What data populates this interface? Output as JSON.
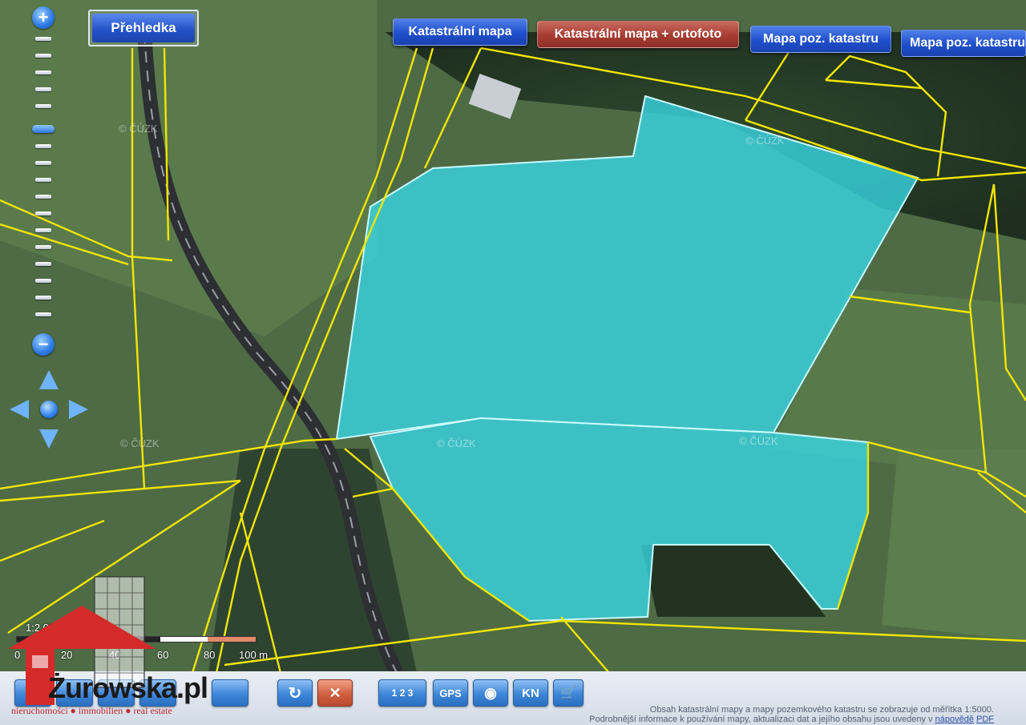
{
  "map": {
    "watermark": "© ČÚZK",
    "parcel_color": "#38d8e8",
    "boundary_color": "#f2e600"
  },
  "overview": {
    "label": "Přehledka"
  },
  "map_layers": [
    {
      "label": "Katastrální mapa",
      "style": "blue"
    },
    {
      "label": "Katastrální mapa + ortofoto",
      "style": "red",
      "selected": true
    },
    {
      "label": "Mapa poz. katastru",
      "style": "blue"
    },
    {
      "label": "Mapa poz. katastru",
      "style": "blue"
    }
  ],
  "zoom": {
    "in_label": "+",
    "out_label": "−"
  },
  "scale": {
    "ratio": "1:2 000",
    "labels": [
      "0",
      "20",
      "40",
      "60",
      "80",
      "100 m"
    ]
  },
  "toolbar": {
    "buttons": [
      {
        "name": "tool-1",
        "label": "",
        "icon": "blank-icon"
      },
      {
        "name": "tool-2",
        "label": "",
        "icon": "blank-icon"
      },
      {
        "name": "tool-3",
        "label": "",
        "icon": "blank-icon"
      },
      {
        "name": "tool-4",
        "label": "",
        "icon": "blank-icon"
      },
      {
        "name": "tool-5",
        "label": "",
        "icon": "blank-icon"
      },
      {
        "name": "refresh",
        "label": "↻",
        "icon": "refresh-icon"
      },
      {
        "name": "cancel",
        "label": "✕",
        "icon": "close-icon"
      },
      {
        "name": "measure",
        "label": "1 2 3",
        "icon": "ruler-icon"
      },
      {
        "name": "gps",
        "label": "GPS",
        "icon": "gps-icon"
      },
      {
        "name": "view",
        "label": "◉",
        "icon": "eye-icon"
      },
      {
        "name": "kn",
        "label": "KN",
        "icon": "kn-icon"
      },
      {
        "name": "cart",
        "label": "🛒",
        "icon": "cart-icon"
      }
    ]
  },
  "footer": {
    "line1": "Obsah katastrální mapy a mapy pozemkového katastru se zobrazuje od měřítka 1:5000.",
    "line2": "Podrobnější informace k používání mapy, aktualizaci dat a jejího obsahu jsou uvedeny v",
    "help_link": "nápovědě",
    "pdf_link": "PDF"
  },
  "logo": {
    "name": "Żurowska.pl",
    "tagline": "nieruchomości ● immobilien ● real estate"
  }
}
